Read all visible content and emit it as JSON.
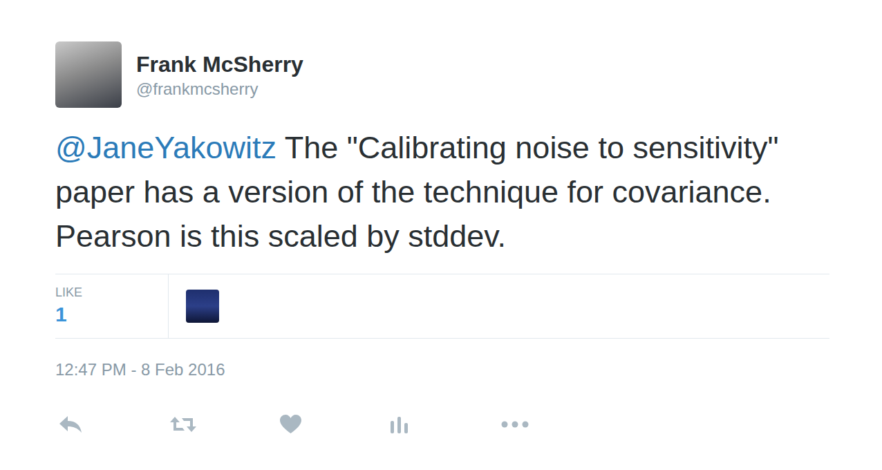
{
  "author": {
    "name": "Frank McSherry",
    "handle": "@frankmcsherry"
  },
  "tweet": {
    "mention": "@JaneYakowitz",
    "text": "The \"Calibrating noise to sensitivity\" paper has a version of the technique for covariance. Pearson is this scaled by stddev."
  },
  "stats": {
    "label": "LIKE",
    "count": "1"
  },
  "timestamp": "12:47 PM - 8 Feb 2016"
}
